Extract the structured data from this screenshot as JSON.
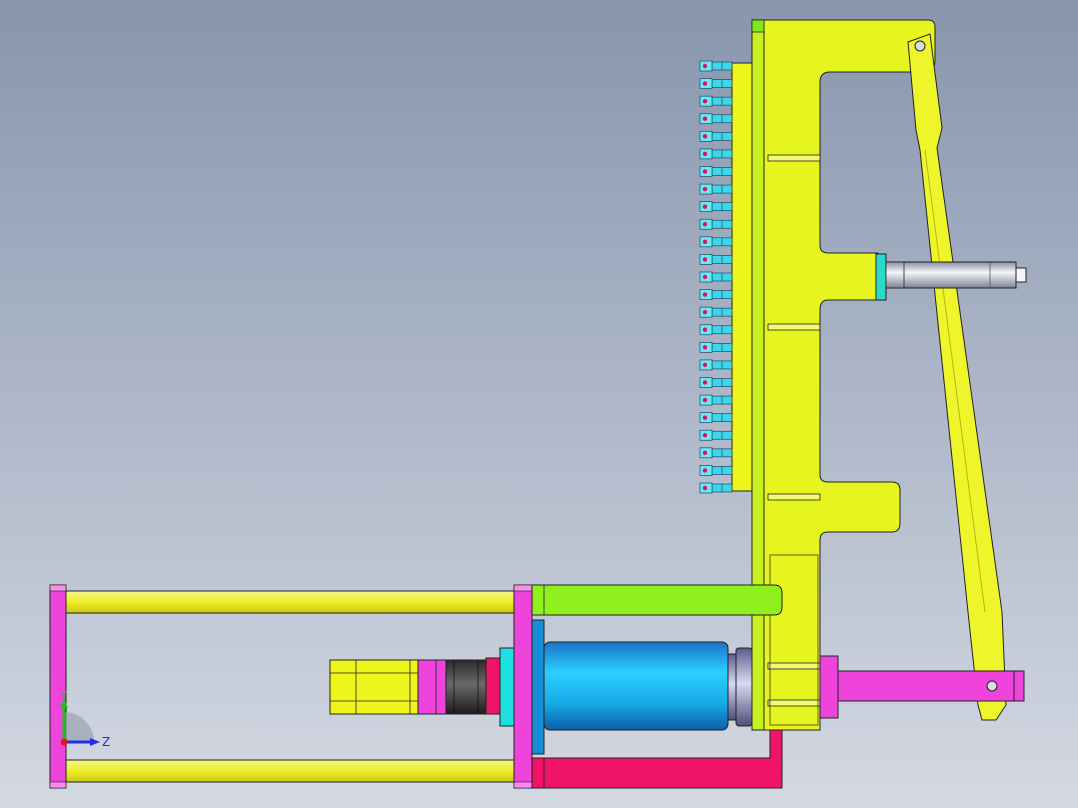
{
  "viewport": {
    "background_top": "#8796ad",
    "background_bottom": "#d4d9e2"
  },
  "parts": {
    "frame_color": "#e8f520",
    "rod_color": "#f0f03a",
    "plate_color": "#ee3fd6",
    "cylinder_color": "#1ec3f5",
    "green_bar_color": "#99f026",
    "red_bracket_color": "#f0156c",
    "pin_color": "#e0e4ea",
    "bolt_count": 25
  },
  "triad": {
    "y_label": "Y",
    "z_label": "Z",
    "y_color": "#18c418",
    "z_color": "#2030e0",
    "x_color": "#e01818"
  }
}
